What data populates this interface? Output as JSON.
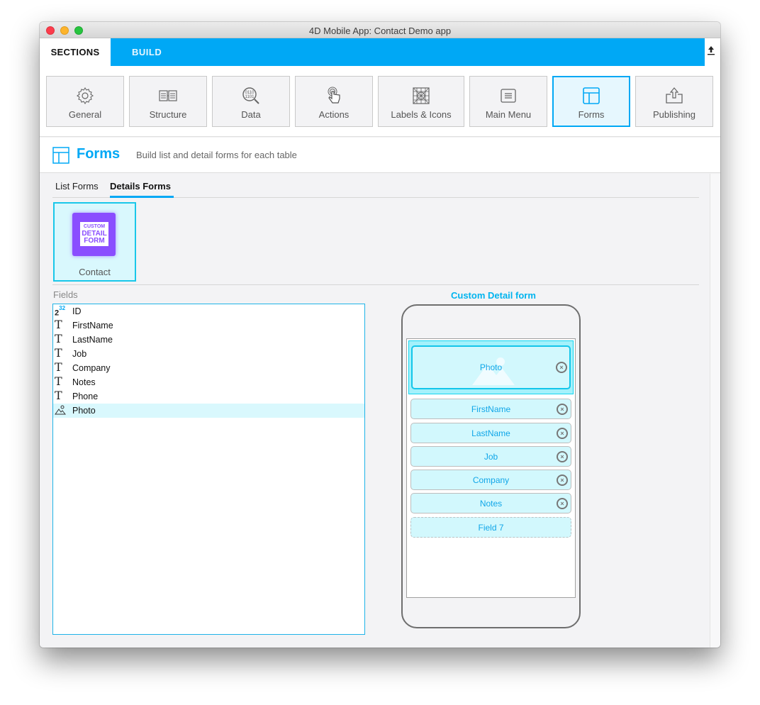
{
  "window": {
    "title": "4D Mobile App: Contact Demo app"
  },
  "topbar": {
    "tabs": [
      {
        "label": "SECTIONS",
        "active": true
      },
      {
        "label": "BUILD",
        "active": false
      }
    ],
    "accent": "#00a8f5",
    "upload_icon": "upload-icon"
  },
  "sections": [
    {
      "label": "General",
      "icon": "gear-icon"
    },
    {
      "label": "Structure",
      "icon": "structure-icon"
    },
    {
      "label": "Data",
      "icon": "data-search-icon"
    },
    {
      "label": "Actions",
      "icon": "tap-hand-icon"
    },
    {
      "label": "Labels & Icons",
      "icon": "labels-icons-icon"
    },
    {
      "label": "Main Menu",
      "icon": "menu-icon"
    },
    {
      "label": "Forms",
      "icon": "forms-icon",
      "active": true
    },
    {
      "label": "Publishing",
      "icon": "publish-icon"
    }
  ],
  "header": {
    "title": "Forms",
    "subtitle": "Build list and detail forms for each table"
  },
  "subtabs": [
    {
      "label": "List Forms",
      "active": false
    },
    {
      "label": "Details Forms",
      "active": true
    }
  ],
  "form_templates": [
    {
      "table": "Contact",
      "thumb_lines": [
        "CUSTOM",
        "DETAIL",
        "FORM"
      ],
      "selected": true
    }
  ],
  "fields_panel": {
    "label": "Fields",
    "fields": [
      {
        "name": "ID",
        "type": "integer",
        "icon_text": "2",
        "icon_sup": "32"
      },
      {
        "name": "FirstName",
        "type": "text",
        "icon_text": "T"
      },
      {
        "name": "LastName",
        "type": "text",
        "icon_text": "T"
      },
      {
        "name": "Job",
        "type": "text",
        "icon_text": "T"
      },
      {
        "name": "Company",
        "type": "text",
        "icon_text": "T"
      },
      {
        "name": "Notes",
        "type": "text",
        "icon_text": "T"
      },
      {
        "name": "Phone",
        "type": "text",
        "icon_text": "T"
      },
      {
        "name": "Photo",
        "type": "picture",
        "icon_text": "",
        "selected": true
      }
    ]
  },
  "preview": {
    "title": "Custom Detail form",
    "photo_slot": {
      "label": "Photo",
      "remove_icon": "⊗"
    },
    "slots": [
      {
        "label": "FirstName",
        "filled": true,
        "remove_icon": "×"
      },
      {
        "label": "LastName",
        "filled": true,
        "remove_icon": "×"
      },
      {
        "label": "Job",
        "filled": true,
        "remove_icon": "×"
      },
      {
        "label": "Company",
        "filled": true,
        "remove_icon": "×"
      },
      {
        "label": "Notes",
        "filled": true,
        "remove_icon": "×"
      },
      {
        "label": "Field 7",
        "filled": false
      }
    ]
  }
}
